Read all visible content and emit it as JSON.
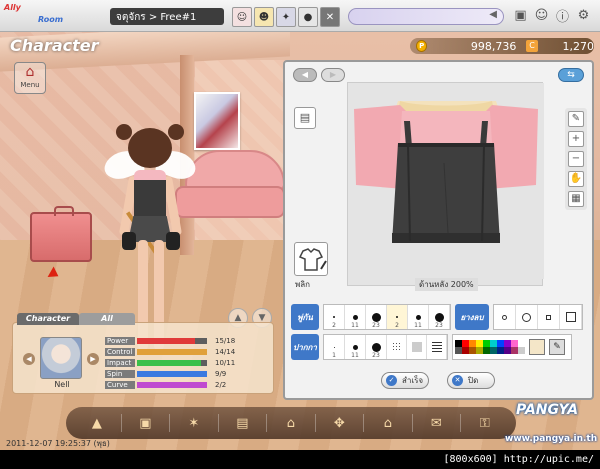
{
  "topbar": {
    "logo_main": "Ally",
    "logo_sub": "Room",
    "location": "จตุจักร > Free#1",
    "players": [
      {
        "icon": "avatar-1",
        "glyph": "☺"
      },
      {
        "icon": "avatar-2",
        "glyph": "☻"
      },
      {
        "icon": "avatar-3",
        "glyph": "✦"
      },
      {
        "icon": "avatar-4",
        "glyph": "●"
      }
    ],
    "close_glyph": "✕",
    "chat_glyph": "◀"
  },
  "hud": {
    "section_title": "Character",
    "menu_label": "Menu",
    "pang_icon": "P",
    "pang_amount": "998,736",
    "cookie_icon": "C",
    "cookie_amount": "1,270"
  },
  "editor": {
    "prev": "◀",
    "next": "▶",
    "link": "⇆",
    "part_label": "พลิก",
    "canvas_caption": "ด้านหลัง 200%",
    "brush_tab": "พู่กัน",
    "erase_tab": "ยางลบ",
    "pattern_tab": "ปากกา",
    "brush_sizes": [
      {
        "size": 2,
        "label": "2",
        "dot": 2
      },
      {
        "size": 11,
        "label": "11",
        "dot": 5
      },
      {
        "size": 23,
        "label": "23",
        "dot": 9
      },
      {
        "size": 2,
        "label": "2",
        "dot": 2,
        "selected": true
      },
      {
        "size": 11,
        "label": "11",
        "dot": 5
      },
      {
        "size": 23,
        "label": "23",
        "dot": 9
      }
    ],
    "pen_sizes": [
      {
        "label": "1",
        "dot": 1
      },
      {
        "label": "11",
        "dot": 5
      },
      {
        "label": "23",
        "dot": 9
      }
    ],
    "palette": [
      "#000000",
      "#ff0000",
      "#ff8800",
      "#ffee00",
      "#00cc00",
      "#00cccc",
      "#0044ff",
      "#8800cc",
      "#ff66cc",
      "#ffffff",
      "#555555",
      "#aa0000",
      "#aa5500",
      "#aaaa00",
      "#006600",
      "#006666",
      "#002288",
      "#550088",
      "#aa3366",
      "#cccccc"
    ],
    "current_color": "#f4e6c8",
    "confirm_label": "สำเร็จ",
    "cancel_label": "ปิด"
  },
  "card": {
    "tab_active": "Character",
    "tab_inactive": "All",
    "name": "Nell",
    "stats": [
      {
        "name": "Power",
        "value": "15/18",
        "ratio": 0.83,
        "color": "#e03a3a"
      },
      {
        "name": "Control",
        "value": "14/14",
        "ratio": 1.0,
        "color": "#e0a03a"
      },
      {
        "name": "Impact",
        "value": "10/11",
        "ratio": 0.91,
        "color": "#3ac04a"
      },
      {
        "name": "Spin",
        "value": "9/9",
        "ratio": 1.0,
        "color": "#3a7ae0"
      },
      {
        "name": "Curve",
        "value": "2/2",
        "ratio": 1.0,
        "color": "#c04ad0"
      }
    ]
  },
  "bottom": {
    "icons": [
      "shop-icon",
      "locker-icon",
      "character-icon",
      "gift-icon",
      "mail-icon",
      "puzzle-icon",
      "home-icon",
      "cart-icon",
      "lock-icon"
    ],
    "glyphs": [
      "▲",
      "▣",
      "✶",
      "▤",
      "⌂",
      "✥",
      "⌂",
      "✉",
      "⚿"
    ]
  },
  "timestamp": "2011-12-07 19:25:37 (พุธ)",
  "brand": "PANGYA",
  "brand_url": "www.pangya.in.th",
  "footer": "[800x600] http://upic.me/"
}
